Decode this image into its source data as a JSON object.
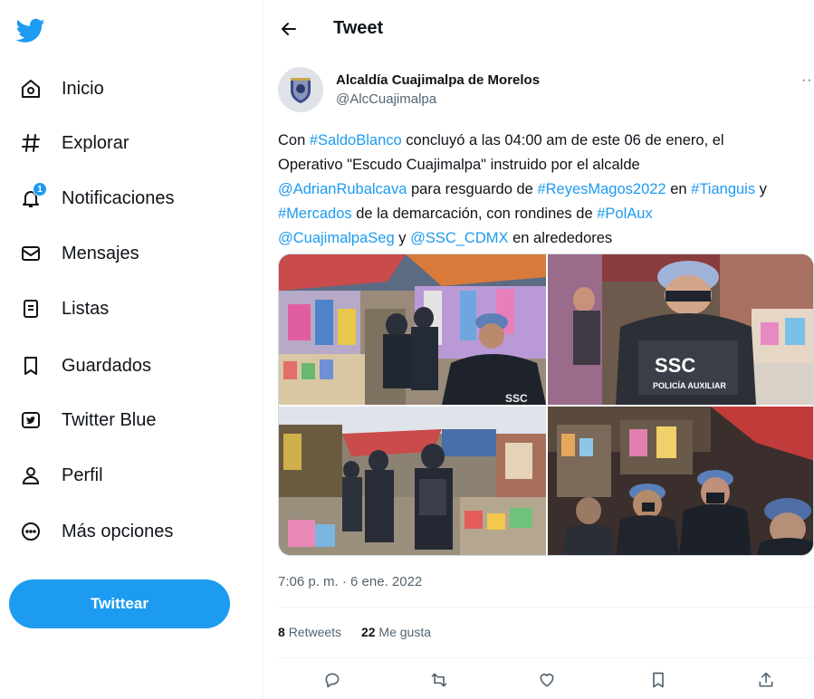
{
  "sidebar": {
    "logo": "twitter-bird-icon",
    "items": [
      {
        "label": "Inicio",
        "icon": "home-icon"
      },
      {
        "label": "Explorar",
        "icon": "hashtag-icon"
      },
      {
        "label": "Notificaciones",
        "icon": "bell-icon",
        "badge": "1"
      },
      {
        "label": "Mensajes",
        "icon": "envelope-icon"
      },
      {
        "label": "Listas",
        "icon": "list-icon"
      },
      {
        "label": "Guardados",
        "icon": "bookmark-icon"
      },
      {
        "label": "Twitter Blue",
        "icon": "twitter-blue-icon"
      },
      {
        "label": "Perfil",
        "icon": "person-icon"
      },
      {
        "label": "Más opciones",
        "icon": "more-circle-icon"
      }
    ],
    "tweet_button": "Twittear"
  },
  "header": {
    "back_icon": "back-arrow-icon",
    "title": "Tweet"
  },
  "tweet": {
    "author_name": "Alcaldía Cuajimalpa de Morelos",
    "author_handle": "@AlcCuajimalpa",
    "more": "···",
    "text": {
      "l1_a": "Con ",
      "l1_b": "#SaldoBlanco",
      "l1_c": " concluyó a las 04:00 am de este 06 de enero, el",
      "l2_a": "Operativo \"Escudo Cuajimalpa\" instruido por el alcalde",
      "l3_a": "@AdrianRubalcava",
      "l3_b": " para resguardo de ",
      "l3_c": "#ReyesMagos2022",
      "l3_d": " en ",
      "l3_e": "#Tianguis",
      "l3_f": " y",
      "l4_a": "#Mercados",
      "l4_b": " de la demarcación, con rondines de ",
      "l4_c": "#PolAux",
      "l5_a": "@CuajimalpaSeg",
      "l5_b": " y ",
      "l5_c": "@SSC_CDMX",
      "l5_d": " en alrededores"
    },
    "photos": [
      {
        "label": "SSC"
      },
      {
        "label": "SSC",
        "sublabel": "POLICÍA AUXILIAR"
      },
      {
        "label": ""
      },
      {
        "label": ""
      }
    ],
    "timestamp": "7:06 p. m. · 6 ene. 2022",
    "retweets_count": "8",
    "retweets_label": "Retweets",
    "likes_count": "22",
    "likes_label": "Me gusta",
    "actions": [
      "reply-icon",
      "retweet-icon",
      "like-icon",
      "bookmark-icon",
      "share-icon"
    ]
  },
  "colors": {
    "accent": "#1d9bf0",
    "text": "#0f1419",
    "muted": "#536471"
  }
}
